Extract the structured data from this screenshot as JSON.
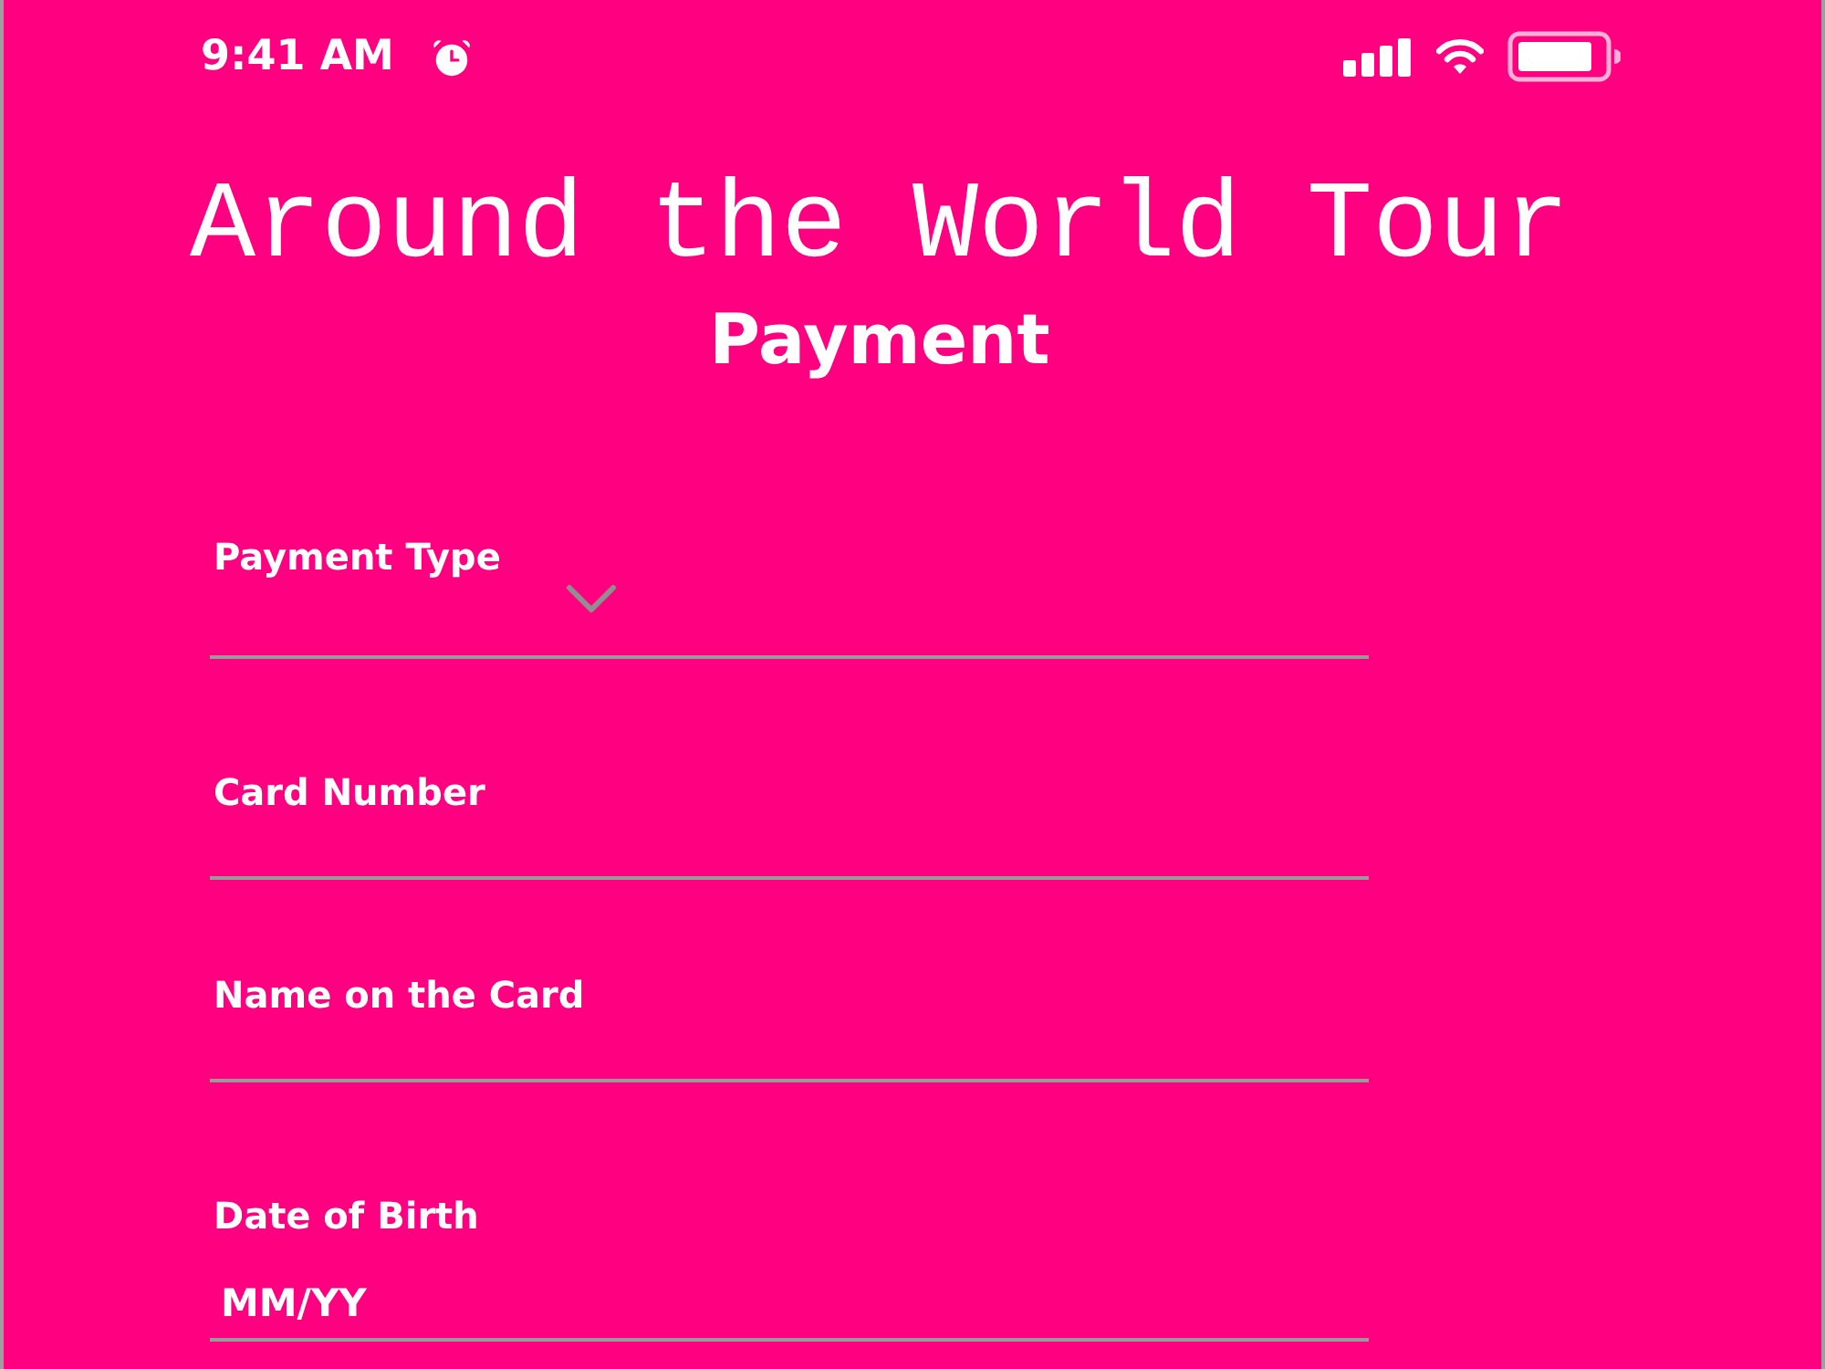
{
  "status_bar": {
    "time": "9:41 AM"
  },
  "header": {
    "title": "Around the World Tour",
    "subtitle": "Payment"
  },
  "form": {
    "fields": [
      {
        "kind": "select",
        "label": "Payment Type"
      },
      {
        "kind": "text",
        "label": "Card Number"
      },
      {
        "kind": "text",
        "label": "Name on the Card"
      },
      {
        "kind": "text",
        "label": "Date of Birth",
        "placeholder": "MM/YY"
      }
    ]
  }
}
